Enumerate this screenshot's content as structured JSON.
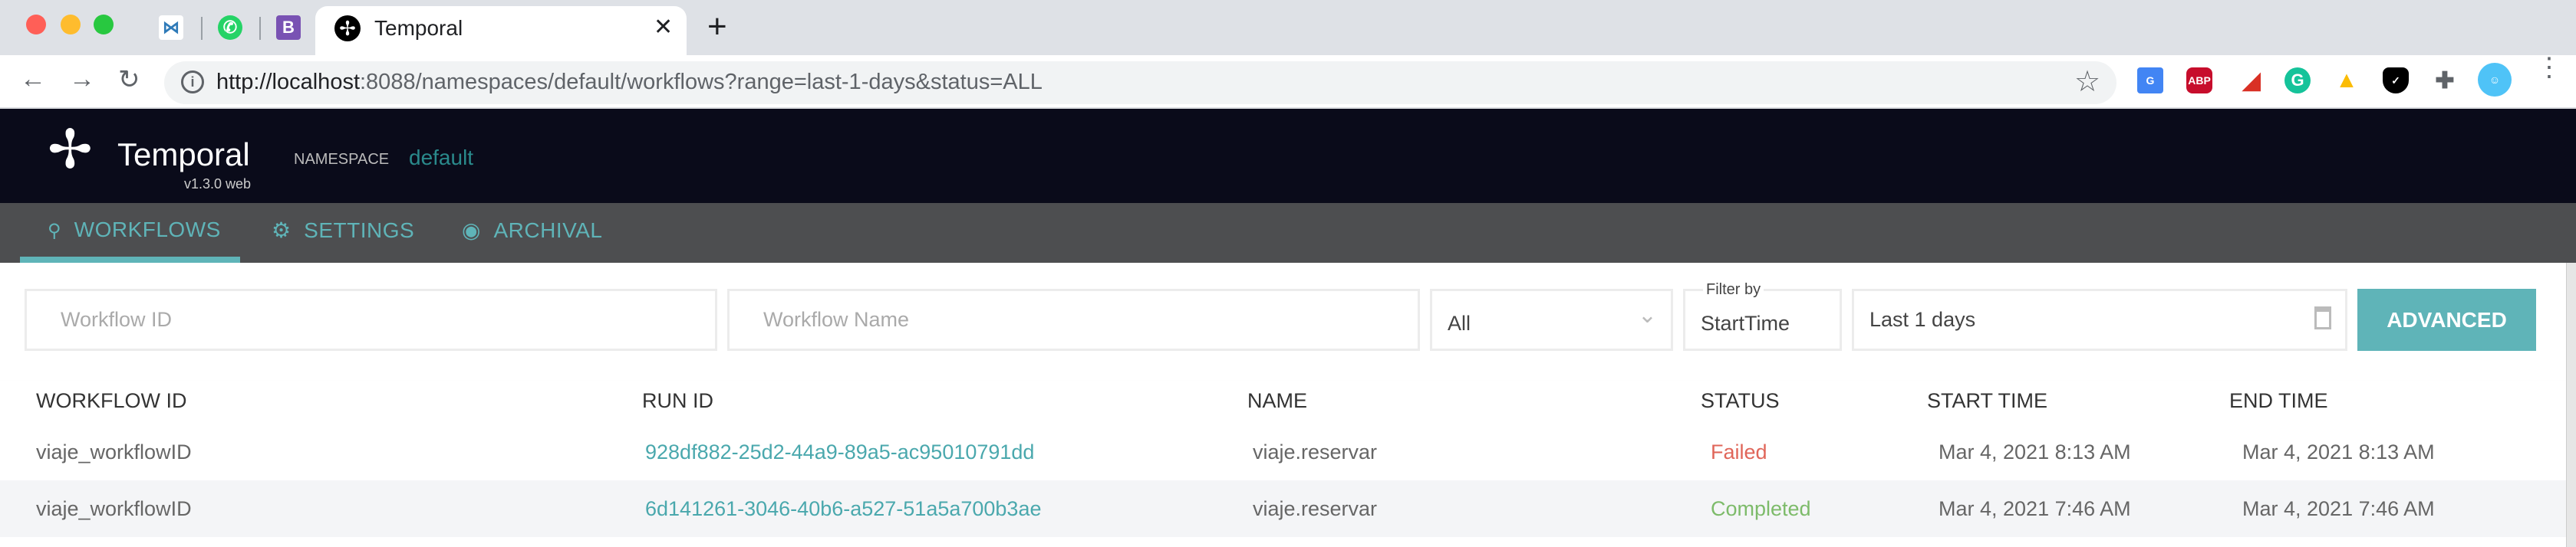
{
  "browser": {
    "tab_title": "Temporal",
    "pinned_tabs": [
      "bowtie-icon",
      "whatsapp-icon",
      "bootstrap-icon"
    ],
    "url_host": "http://localhost",
    "url_rest": ":8088/namespaces/default/workflows?range=last-1-days&status=ALL",
    "extensions": [
      "google-translate-icon",
      "adblock-plus-icon",
      "acrobat-icon",
      "grammarly-icon",
      "google-drive-icon",
      "shield-check-icon",
      "puzzle-icon",
      "profile-avatar",
      "menu-icon"
    ],
    "abp_label": "ABP"
  },
  "app": {
    "brand": "Temporal",
    "version": "v1.3.0 web",
    "namespace_label": "NAMESPACE",
    "namespace_value": "default",
    "accent": "#5fb4b8"
  },
  "nav": {
    "items": [
      {
        "label": "WORKFLOWS",
        "icon": "search-icon",
        "active": true
      },
      {
        "label": "SETTINGS",
        "icon": "gear-icon"
      },
      {
        "label": "ARCHIVAL",
        "icon": "archive-icon"
      }
    ]
  },
  "filters": {
    "workflow_id_placeholder": "Workflow ID",
    "workflow_name_placeholder": "Workflow Name",
    "status_value": "All",
    "filter_by_label": "Filter by",
    "filter_by_value": "StartTime",
    "range_value": "Last 1 days",
    "advanced_label": "ADVANCED"
  },
  "table": {
    "headers": [
      "WORKFLOW ID",
      "RUN ID",
      "NAME",
      "STATUS",
      "START TIME",
      "END TIME"
    ],
    "rows": [
      {
        "workflow_id": "viaje_workflowID",
        "run_id": "928df882-25d2-44a9-89a5-ac95010791dd",
        "name": "viaje.reservar",
        "status": "Failed",
        "start": "Mar 4, 2021 8:13 AM",
        "end": "Mar 4, 2021 8:13 AM"
      },
      {
        "workflow_id": "viaje_workflowID",
        "run_id": "6d141261-3046-40b6-a527-51a5a700b3ae",
        "name": "viaje.reservar",
        "status": "Completed",
        "start": "Mar 4, 2021 7:46 AM",
        "end": "Mar 4, 2021 7:46 AM"
      }
    ],
    "status_colors": {
      "Failed": "#e0665a",
      "Completed": "#7dbb6a"
    }
  }
}
